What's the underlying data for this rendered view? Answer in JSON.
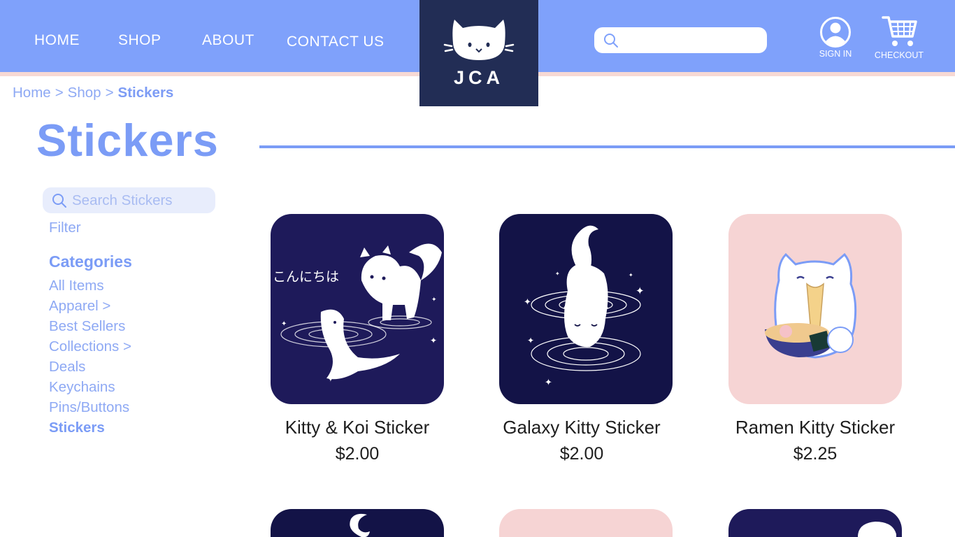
{
  "header": {
    "nav": [
      "HOME",
      "SHOP",
      "ABOUT",
      "CONTACT US"
    ],
    "logo_text": "JCA",
    "search_placeholder": "",
    "sign_in_label": "SIGN IN",
    "checkout_label": "CHECKOUT"
  },
  "breadcrumb": {
    "items": [
      "Home",
      "Shop",
      "Stickers"
    ],
    "separator": ">"
  },
  "page_title": "Stickers",
  "sidebar": {
    "search_placeholder": "Search Stickers",
    "filter_label": "Filter",
    "categories_heading": "Categories",
    "categories": [
      "All Items",
      "Apparel >",
      "Best Sellers",
      "Collections >",
      "Deals",
      "Keychains",
      "Pins/Buttons",
      "Stickers"
    ],
    "active_category": "Stickers"
  },
  "products": [
    {
      "name": "Kitty & Koi Sticker",
      "price": "$2.00",
      "image_text": "こんにちは"
    },
    {
      "name": "Galaxy Kitty Sticker",
      "price": "$2.00"
    },
    {
      "name": "Ramen Kitty Sticker",
      "price": "$2.25"
    }
  ],
  "colors": {
    "header_bg": "#7fa1fb",
    "accent": "#7b9cf6",
    "logo_bg": "#222d55",
    "stripe": "#f7d9d4",
    "card_navy": "#1e1a5a",
    "card_pink": "#f6d4d4"
  },
  "icons": [
    "search-icon",
    "user-icon",
    "cart-icon",
    "cat-logo-icon"
  ]
}
